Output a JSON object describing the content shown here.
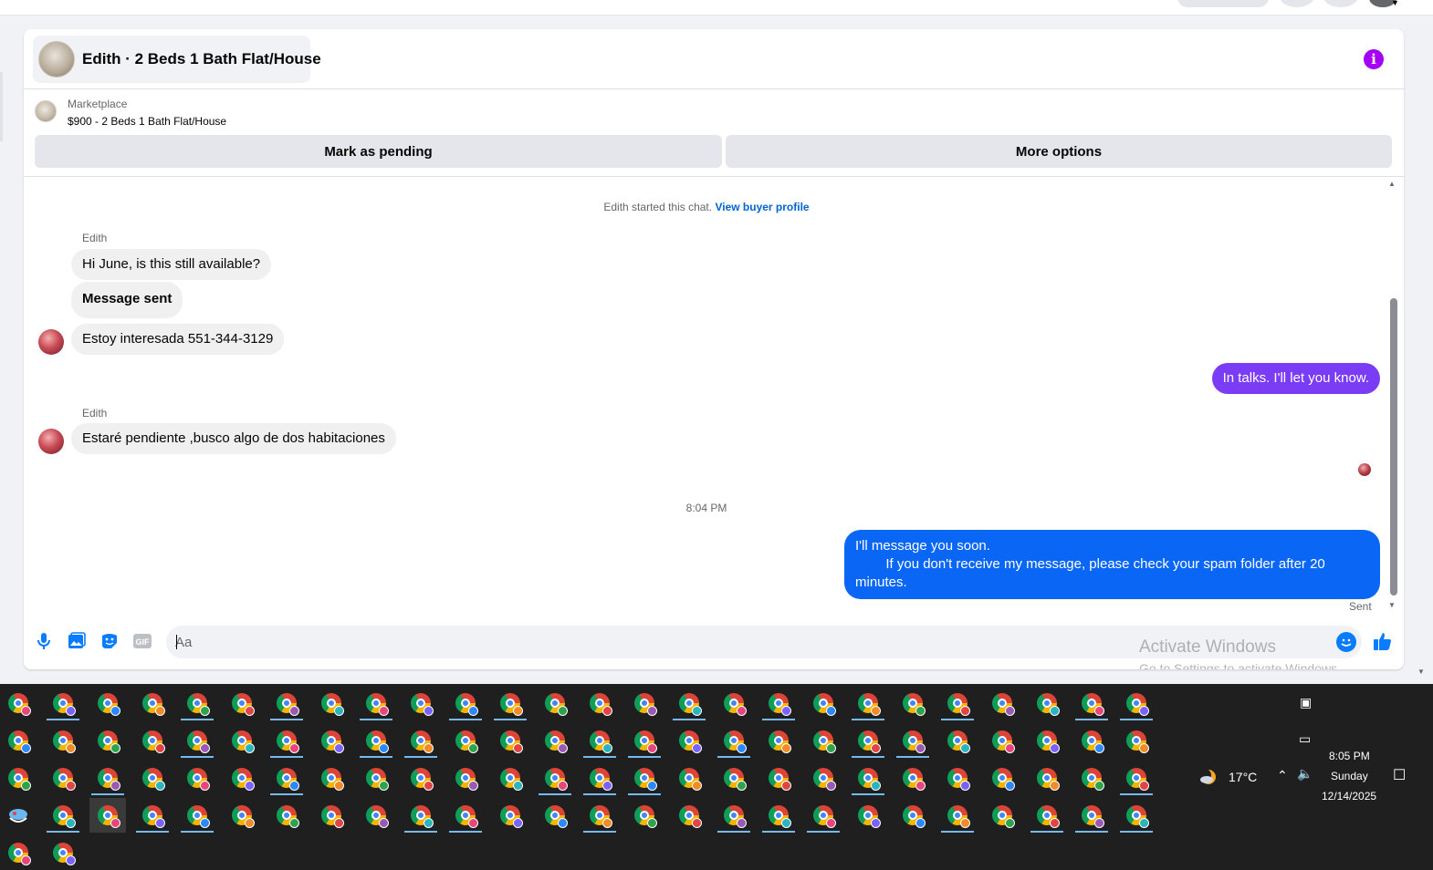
{
  "header": {
    "title": "Edith · 2 Beds 1 Bath Flat/House"
  },
  "listing": {
    "source": "Marketplace",
    "title": "$900 - 2 Beds 1 Bath Flat/House",
    "mark_pending_label": "Mark as pending",
    "more_options_label": "More options"
  },
  "chat": {
    "system_text": "Edith started this chat.",
    "view_buyer_profile": "View buyer profile",
    "sender_1": "Edith",
    "msg_1": "Hi June, is this still available?",
    "msg_2": "Message sent",
    "msg_3": "Estoy interesada 551-344-3129",
    "reply_1": "In talks. I'll let you know.",
    "sender_2": "Edith",
    "msg_4": "Estaré pendiente ,busco algo de dos habitaciones",
    "timestamp": "8:04 PM",
    "reply_2": "I'll message you soon.\n        If you don't receive my message, please check your spam folder after 20 minutes.",
    "status": "Sent"
  },
  "composer": {
    "placeholder": "Aa"
  },
  "watermark": {
    "line1": "Activate Windows",
    "line2": "Go to Settings to activate Windows."
  },
  "tray": {
    "weather": "17°C",
    "time": "8:05 PM",
    "day": "Sunday",
    "date": "12/14/2025"
  },
  "colors": {
    "accent_purple": "#7a3cf5",
    "accent_blue": "#0a66f5",
    "info_purple": "#a400f5",
    "taskbar": "#1f1f1f"
  }
}
